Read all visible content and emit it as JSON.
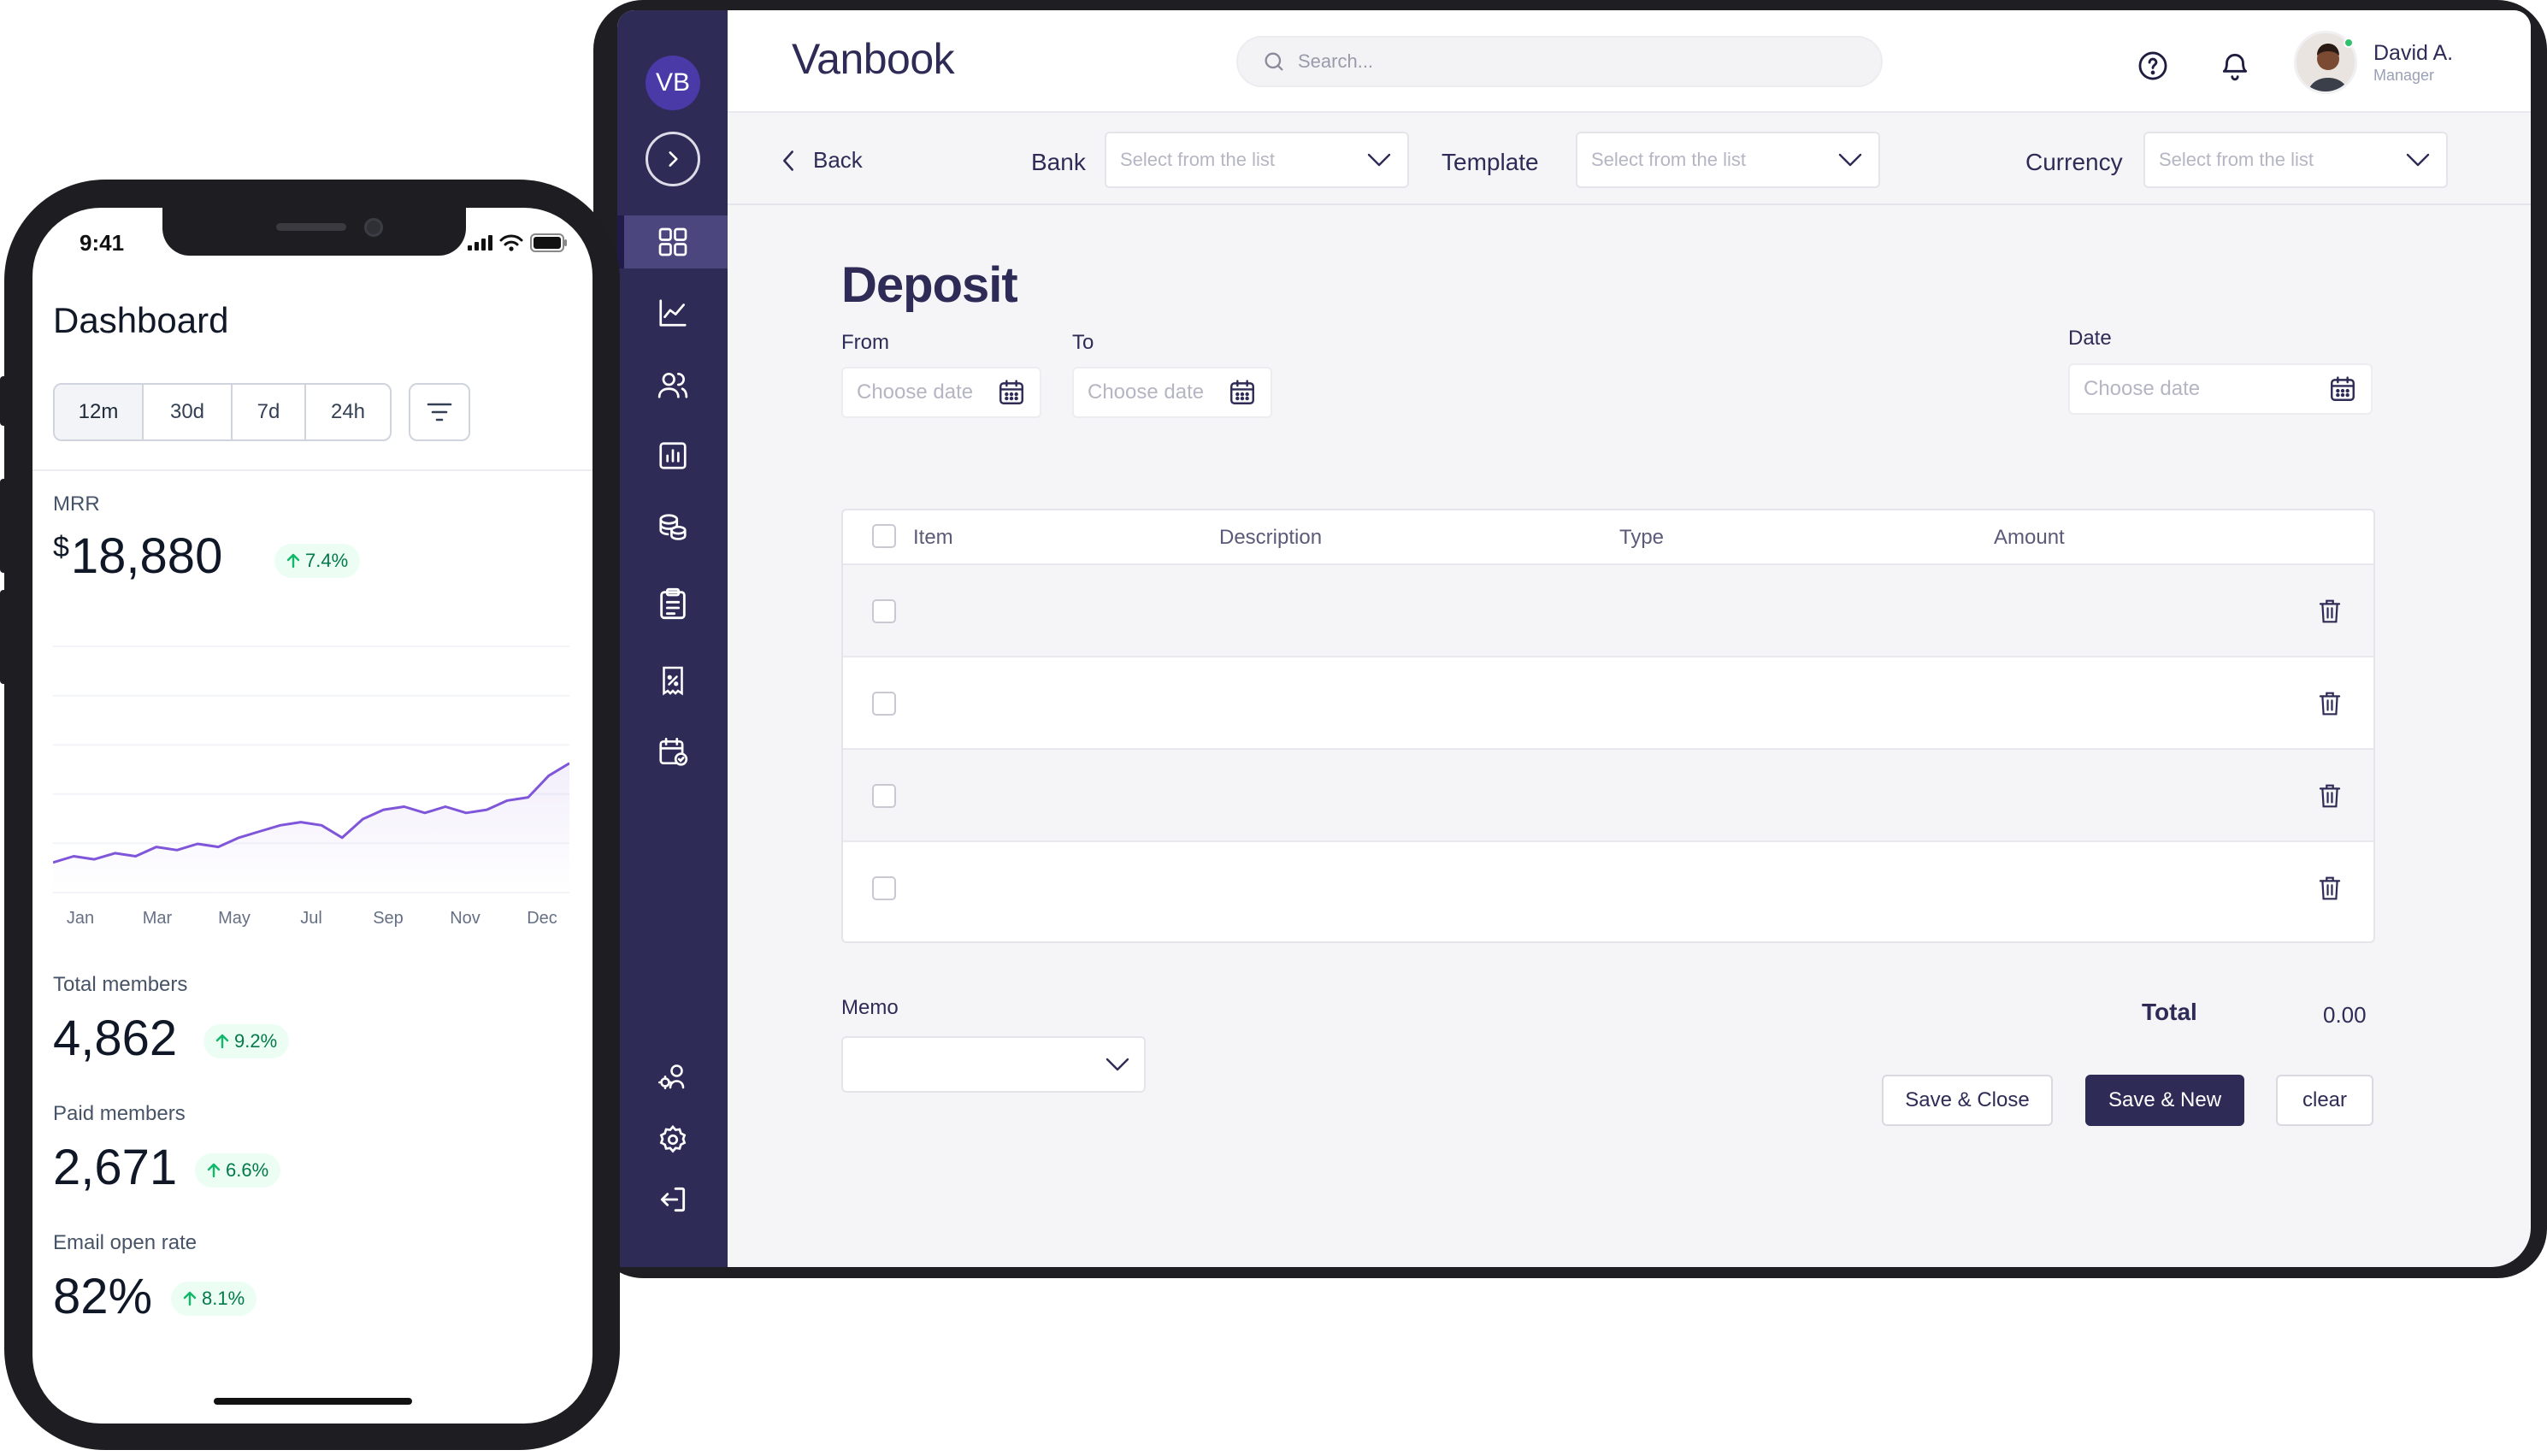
{
  "tablet": {
    "sidebar": {
      "avatar_initials": "VB",
      "items": [
        {
          "icon": "grid-icon"
        },
        {
          "icon": "trend-icon"
        },
        {
          "icon": "users-icon"
        },
        {
          "icon": "bar-chart-icon"
        },
        {
          "icon": "coins-icon"
        },
        {
          "icon": "clipboard-icon"
        },
        {
          "icon": "receipt-icon"
        },
        {
          "icon": "calendar-check-icon"
        },
        {
          "icon": "user-gear-icon"
        },
        {
          "icon": "settings-icon"
        },
        {
          "icon": "logout-icon"
        }
      ]
    },
    "header": {
      "brand": "Vanbook",
      "search_placeholder": "Search...",
      "user_name": "David A.",
      "user_role": "Manager"
    },
    "filters": {
      "back_label": "Back",
      "bank_label": "Bank",
      "bank_placeholder": "Select from the list",
      "template_label": "Template",
      "template_placeholder": "Select from the list",
      "currency_label": "Currency",
      "currency_placeholder": "Select from the list"
    },
    "form": {
      "title": "Deposit",
      "from_label": "From",
      "to_label": "To",
      "date_label": "Date",
      "from_placeholder": "Choose date",
      "to_placeholder": "Choose date",
      "date_placeholder": "Choose date"
    },
    "table": {
      "columns": [
        "Item",
        "Description",
        "Type",
        "Amount"
      ],
      "row_count": 4
    },
    "footer": {
      "memo_label": "Memo",
      "total_label": "Total",
      "total_value": "0.00",
      "save_close": "Save & Close",
      "save_new": "Save & New",
      "clear": "clear"
    },
    "colors": {
      "sidebar": "#2e2b56",
      "primary": "#2e2b56",
      "accent": "#4a3aa8"
    }
  },
  "phone": {
    "time": "9:41",
    "title": "Dashboard",
    "ranges": [
      "12m",
      "30d",
      "7d",
      "24h"
    ],
    "active_range": "12m",
    "mrr": {
      "label": "MRR",
      "currency": "$",
      "value": "18,880",
      "change": "7.4%"
    },
    "metrics": [
      {
        "label": "Total members",
        "value": "4,862",
        "change": "9.2%"
      },
      {
        "label": "Paid members",
        "value": "2,671",
        "change": "6.6%"
      },
      {
        "label": "Email open rate",
        "value": "82%",
        "change": "8.1%"
      }
    ],
    "colors": {
      "line": "#7f56d9",
      "positive": "#027a48"
    }
  },
  "chart_data": {
    "type": "area",
    "x_labels": [
      "Jan",
      "Mar",
      "May",
      "Jul",
      "Sep",
      "Nov",
      "Dec"
    ],
    "series": [
      {
        "values": [
          10,
          12,
          11,
          13,
          12,
          15,
          14,
          16,
          15,
          18,
          20,
          22,
          23,
          22,
          18,
          24,
          27,
          28,
          26,
          28,
          26,
          27,
          30,
          31,
          38,
          42
        ]
      }
    ],
    "ylim": [
      0,
      80
    ]
  }
}
